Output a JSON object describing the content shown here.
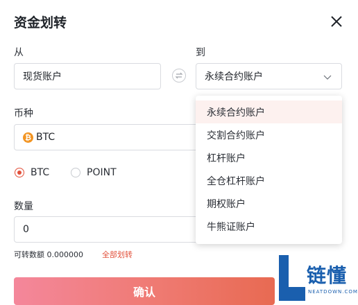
{
  "dialog": {
    "title": "资金划转"
  },
  "from": {
    "label": "从",
    "value": "现货账户"
  },
  "to": {
    "label": "到",
    "value": "永续合约账户"
  },
  "coin": {
    "label": "币种",
    "value": "BTC",
    "icon_glyph": "₿"
  },
  "type_options": [
    {
      "label": "BTC",
      "selected": true
    },
    {
      "label": "POINT",
      "selected": false
    }
  ],
  "amount": {
    "label": "数量",
    "value": "0"
  },
  "available": {
    "text": "可转数额 0.000000",
    "all_link": "全部划转"
  },
  "confirm_label": "确认",
  "dropdown": {
    "options": [
      "永续合约账户",
      "交割合约账户",
      "杠杆账户",
      "全仓杠杆账户",
      "期权账户",
      "牛熊证账户"
    ],
    "selected_index": 0
  },
  "watermark": {
    "cn": "链懂",
    "en": "NEATDOWN.COM"
  },
  "colors": {
    "accent": "#e2503a",
    "logo": "#1a5fae"
  }
}
